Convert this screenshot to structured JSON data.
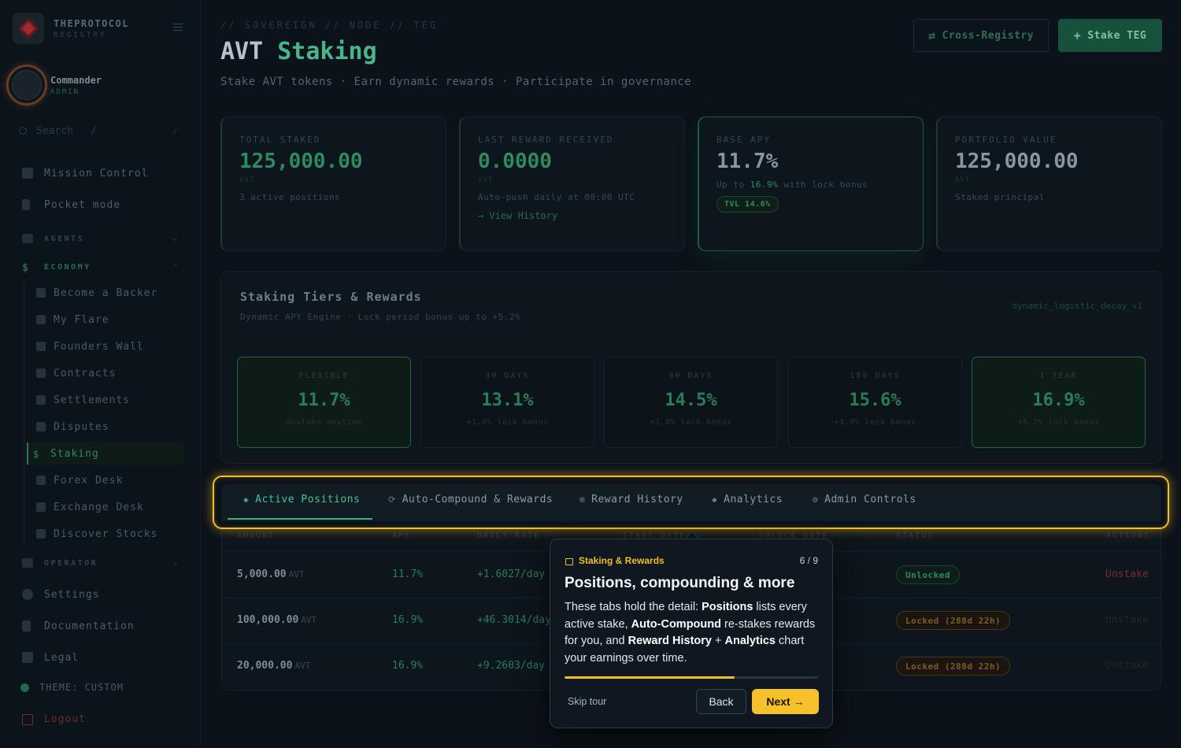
{
  "brand": {
    "name": "THEPROTOCOL",
    "sub": "REGISTRY"
  },
  "user": {
    "name": "Commander",
    "role": "ADMIN"
  },
  "search": {
    "placeholder": "Search",
    "shortcut": "/"
  },
  "nav": {
    "mission_control": "Mission Control",
    "pocket_mode": "Pocket mode",
    "agents": "AGENTS",
    "economy": "ECONOMY",
    "economy_items": [
      "Become a Backer",
      "My Flare",
      "Founders Wall",
      "Contracts",
      "Settlements",
      "Disputes",
      "Staking",
      "Forex Desk",
      "Exchange Desk",
      "Discover Stocks"
    ],
    "operator": "OPERATOR",
    "settings": "Settings",
    "documentation": "Documentation",
    "legal": "Legal",
    "theme": "THEME: CUSTOM",
    "logout": "Logout"
  },
  "header": {
    "breadcrumb": "// SOVEREIGN // NODE // TEG",
    "title_prefix": "AVT",
    "title_accent": "Staking",
    "subtitle": "Stake AVT tokens · Earn dynamic rewards · Participate in governance",
    "cross_registry": "Cross-Registry",
    "stake_teg": "Stake TEG"
  },
  "stats": {
    "total_staked": {
      "label": "TOTAL STAKED",
      "value": "125,000.00",
      "unit": "AVT",
      "note": "3 active positions"
    },
    "last_reward": {
      "label": "LAST REWARD RECEIVED",
      "value": "0.0000",
      "unit": "AVT",
      "note": "Auto-push daily at 00:00 UTC",
      "link": "→ View History"
    },
    "base_apy": {
      "label": "BASE APY",
      "value": "11.7%",
      "note_pre": "Up to",
      "note_hl": "16.9%",
      "note_post": "with lock bonus",
      "badge": "TVL 14.6%"
    },
    "portfolio": {
      "label": "PORTFOLIO VALUE",
      "value": "125,000.00",
      "unit": "AVT",
      "note": "Staked principal"
    }
  },
  "tiers": {
    "title": "Staking Tiers & Rewards",
    "subtitle": "Dynamic APY Engine · Lock period bonus up to +5.2%",
    "engine": "dynamic_logistic_decay_v1",
    "items": [
      {
        "name": "FLEXIBLE",
        "apy": "11.7%",
        "bonus": "Unstake anytime"
      },
      {
        "name": "30 DAYS",
        "apy": "13.1%",
        "bonus": "+1.4% lock bonus"
      },
      {
        "name": "90 DAYS",
        "apy": "14.5%",
        "bonus": "+2.8% lock bonus"
      },
      {
        "name": "180 DAYS",
        "apy": "15.6%",
        "bonus": "+3.9% lock bonus"
      },
      {
        "name": "1 YEAR",
        "apy": "16.9%",
        "bonus": "+5.2% lock bonus"
      }
    ]
  },
  "tabs": [
    {
      "icon": "◈",
      "label": "Active Positions"
    },
    {
      "icon": "⟳",
      "label": "Auto-Compound & Rewards"
    },
    {
      "icon": "⊞",
      "label": "Reward History"
    },
    {
      "icon": "◆",
      "label": "Analytics"
    },
    {
      "icon": "⚙",
      "label": "Admin Controls"
    }
  ],
  "table": {
    "headers": [
      "AMOUNT",
      "APY",
      "DAILY RATE",
      "START DATE",
      "UNLOCK DATE",
      "STATUS",
      "ACTIONS"
    ],
    "rows": [
      {
        "amount": "5,000.00",
        "unit": "AVT",
        "apy": "11.7%",
        "rate": "+1.6027/day",
        "status": "Unlocked",
        "action": "Unstake"
      },
      {
        "amount": "100,000.00",
        "unit": "AVT",
        "apy": "16.9%",
        "rate": "+46.3014/day",
        "status": "Locked (288d 22h)",
        "action": "Unstake"
      },
      {
        "amount": "20,000.00",
        "unit": "AVT",
        "apy": "16.9%",
        "rate": "+9.2603/day",
        "status": "Locked (288d 22h)",
        "action": "Unstake"
      }
    ]
  },
  "tour": {
    "eyebrow": "Staking & Rewards",
    "step": "6 / 9",
    "progress": 0.67,
    "title": "Positions, compounding & more",
    "body": {
      "t1": "These tabs hold the detail: ",
      "b1": "Positions",
      "t2": " lists every active stake, ",
      "b2": "Auto-Compound",
      "t3": " re-stakes rewards for you, and ",
      "b3": "Reward History",
      "t4": " + ",
      "b4": "Analytics",
      "t5": " chart your earnings over time."
    },
    "skip": "Skip tour",
    "back": "Back",
    "next": "Next →"
  },
  "colors": {
    "accent": "#49b58a",
    "tour": "#f2bd28",
    "danger": "#7d2a2e"
  }
}
